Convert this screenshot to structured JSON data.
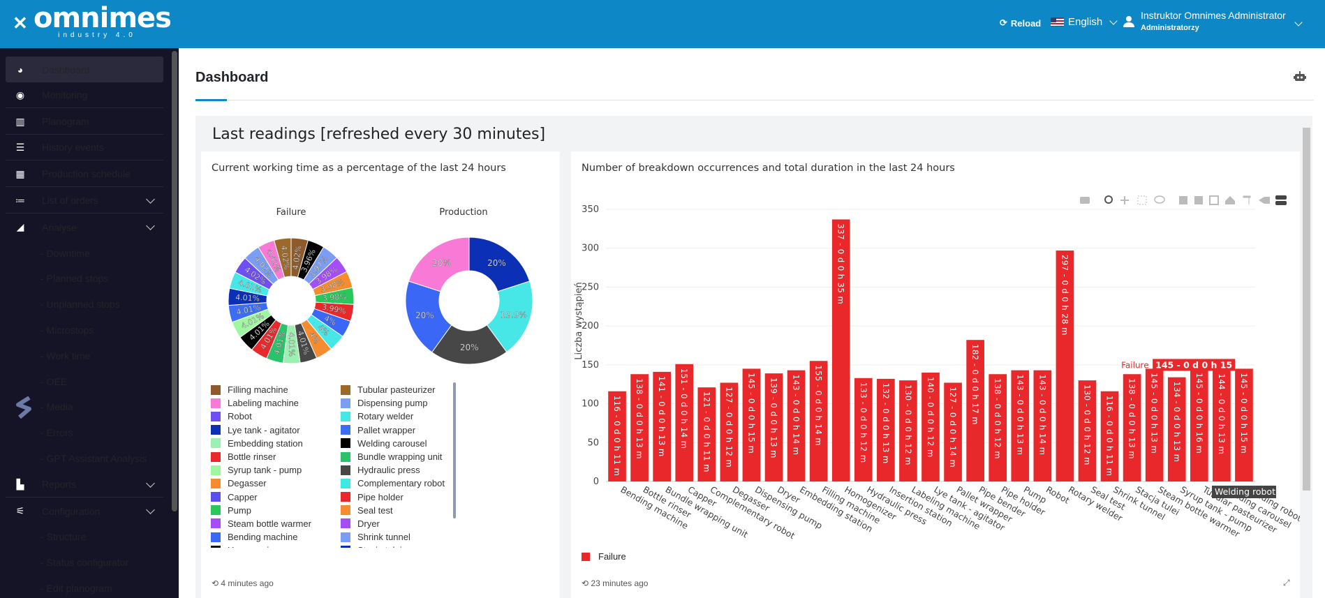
{
  "topbar": {
    "logo": "omnimes",
    "logo_sub": "industry 4.0",
    "reload": "Reload",
    "language": "English",
    "user_name": "Instruktor Omnimes Administrator",
    "user_role": "Administratorzy"
  },
  "sidebar": {
    "items": [
      {
        "label": "Dashboard",
        "icon": "gauge-icon"
      },
      {
        "label": "Monitoring",
        "icon": "eye-icon"
      },
      {
        "label": "Planogram",
        "icon": "map-icon"
      },
      {
        "label": "History events",
        "icon": "list-icon"
      },
      {
        "label": "Production schedule",
        "icon": "calendar-icon"
      },
      {
        "label": "List of orders",
        "icon": "list-ul-icon"
      },
      {
        "label": "Analyse",
        "icon": "chart-area-icon"
      }
    ],
    "analyse_sub": [
      "- Downtime",
      "- Planned stops",
      "- Unplanned stops",
      "- Microstops",
      "- Work time",
      "- OEE",
      "- Media",
      "- Errors",
      "- GPT Assistant Analysis"
    ],
    "reports": "Reports",
    "configuration": "Configuration",
    "config_sub": [
      "- Structure",
      "- Status configurator",
      "- Edit planogram"
    ]
  },
  "page": {
    "title": "Dashboard",
    "panel_title": "Last readings [refreshed every 30 minutes]"
  },
  "pie_card": {
    "title": "Current working time as a percentage of the last 24 hours",
    "updated": "4 minutes ago",
    "legend_left": [
      "Filling machine",
      "Labeling machine",
      "Robot",
      "Lye tank - agitator",
      "Embedding station",
      "Bottle rinser",
      "Syrup tank - pump",
      "Degasser",
      "Capper",
      "Pump",
      "Steam bottle warmer",
      "Bending machine",
      "Homogenizer"
    ],
    "legend_right": [
      "Tubular pasteurizer",
      "Dispensing pump",
      "Rotary welder",
      "Pallet wrapper",
      "Welding carousel",
      "Bundle wrapping unit",
      "Hydraulic press",
      "Complementary robot",
      "Pipe holder",
      "Seal test",
      "Dryer",
      "Shrink tunnel",
      "Stacja tulei"
    ],
    "legend_left_colors": [
      "#8c5a2b",
      "#f97ad6",
      "#6f4ef2",
      "#0b2fb5",
      "#9cf0b0",
      "#e8282a",
      "#9ff7a0",
      "#f58c2f",
      "#5b4ef0",
      "#28c85a",
      "#a64ef5",
      "#3a67f5",
      "#111111"
    ],
    "legend_right_colors": [
      "#9b6a2b",
      "#7b9ef5",
      "#47e7e7",
      "#3b6ef5",
      "#000000",
      "#2ac36a",
      "#474747",
      "#3fe9e3",
      "#e8282a",
      "#f58c2f",
      "#a64ef5",
      "#7b9ef5",
      "#0b2fb5"
    ]
  },
  "failure_pie": {
    "title": "Failure",
    "slices": [
      {
        "label": "4.02%",
        "value": 4.02,
        "color": "#8c5a2b"
      },
      {
        "label": "3.96%",
        "value": 3.96,
        "color": "#000000"
      },
      {
        "label": "3.97%",
        "value": 3.97,
        "color": "#7b9ef5"
      },
      {
        "label": "3.98%",
        "value": 3.98,
        "color": "#a64ef5"
      },
      {
        "label": "3.98%",
        "value": 3.98,
        "color": "#f58c2f"
      },
      {
        "label": "3.98%",
        "value": 3.98,
        "color": "#28c85a"
      },
      {
        "label": "3.99%",
        "value": 3.99,
        "color": "#e8282a"
      },
      {
        "label": "4%",
        "value": 4.0,
        "color": "#3a67f5"
      },
      {
        "label": "4%",
        "value": 4.0,
        "color": "#47e7e7"
      },
      {
        "label": "4%",
        "value": 4.0,
        "color": "#f58c2f"
      },
      {
        "label": "4.01%",
        "value": 4.01,
        "color": "#474747"
      },
      {
        "label": "4.01%",
        "value": 4.01,
        "color": "#9cf0b0"
      },
      {
        "label": "4.01%",
        "value": 4.01,
        "color": "#2ac36a"
      },
      {
        "label": "4.01%",
        "value": 4.01,
        "color": "#e8282a"
      },
      {
        "label": "4.01%",
        "value": 4.01,
        "color": "#000000"
      },
      {
        "label": "4.01%",
        "value": 4.01,
        "color": "#9ff7a0"
      },
      {
        "label": "4.01%",
        "value": 4.01,
        "color": "#3b6ef5"
      },
      {
        "label": "4.01%",
        "value": 4.01,
        "color": "#0b2fb5"
      },
      {
        "label": "4.01%",
        "value": 4.01,
        "color": "#47e7e7"
      },
      {
        "label": "4.02%",
        "value": 4.02,
        "color": "#6f4ef2"
      },
      {
        "label": "4.02%",
        "value": 4.02,
        "color": "#7b9ef5"
      },
      {
        "label": "4.02%",
        "value": 4.02,
        "color": "#f97ad6"
      },
      {
        "label": "4.02%",
        "value": 4.02,
        "color": "#9b6a2b"
      }
    ]
  },
  "production_pie": {
    "title": "Production",
    "slices": [
      {
        "label": "20%",
        "value": 20,
        "color": "#0b2fb5"
      },
      {
        "label": "19.9%",
        "value": 19.9,
        "color": "#47e7e7"
      },
      {
        "label": "20%",
        "value": 20,
        "color": "#474747"
      },
      {
        "label": "20%",
        "value": 20,
        "color": "#3a67f5"
      },
      {
        "label": "20%",
        "value": 20,
        "color": "#f97ad6"
      }
    ]
  },
  "bar_card": {
    "title": "Number of breakdown occurrences and total duration in the last 24 hours",
    "updated": "23 minutes ago",
    "legend": "Failure",
    "tooltip_value": "145 - 0 d 0 h 15 m",
    "tooltip_label": "Welding robot"
  },
  "chart_data": {
    "type": "bar",
    "ylabel": "Liczba wystąpień",
    "ylim": [
      0,
      350
    ],
    "yticks": [
      0,
      50,
      100,
      150,
      200,
      250,
      300,
      350
    ],
    "color": "#e8282a",
    "series": [
      {
        "name": "Failure",
        "categories": [
          "Bending machine",
          "Bottle rinser",
          "Bundle wrapping unit",
          "Capper",
          "Complementary robot",
          "Degasser",
          "Dispensing pump",
          "Dryer",
          "Embedding station",
          "Filling machine",
          "Homogenizer",
          "Hydraulic press",
          "Insertion station",
          "Labeling machine",
          "Lye tank - agitator",
          "Pallet wrapper",
          "Pipe bender",
          "Pipe holder",
          "Pump",
          "Robot",
          "Rotary welder",
          "Seal test",
          "Shrink tunnel",
          "Stacja tulei",
          "Steam bottle warmer",
          "Syrup tank - pump",
          "Tubular pasteurizer",
          "Welding carousel",
          "Welding robot"
        ],
        "values": [
          116,
          138,
          141,
          151,
          121,
          127,
          145,
          139,
          143,
          155,
          337,
          133,
          132,
          130,
          140,
          127,
          182,
          138,
          143,
          143,
          297,
          130,
          116,
          138,
          145,
          134,
          145,
          144,
          145
        ],
        "labels": [
          "116 - 0 d 0 h 11 m",
          "138 - 0 d 0 h 13 m",
          "141 - 0 d 0 h 13 m",
          "151 - 0 d 0 h 14 m",
          "121 - 0 d 0 h 11 m",
          "127 - 0 d 0 h 12 m",
          "145 - 0 d 0 h 15 m",
          "139 - 0 d 0 h 13 m",
          "143 - 0 d 0 h 14 m",
          "155 - 0 d 0 h 14 m",
          "337 - 0 d 0 h 35 m",
          "133 - 0 d 0 h 12 m",
          "132 - 0 d 0 h 13 m",
          "130 - 0 d 0 h 12 m",
          "140 - 0 d 0 h 12 m",
          "127 - 0 d 0 h 14 m",
          "182 - 0 d 0 h 17 m",
          "138 - 0 d 0 h 12 m",
          "143 - 0 d 0 h 13 m",
          "143 - 0 d 0 h 14 m",
          "297 - 0 d 0 h 28 m",
          "130 - 0 d 0 h 12 m",
          "116 - 0 d 0 h 11 m",
          "138 - 0 d 0 h 13 m",
          "145 - 0 d 0 h 13 m",
          "134 - 0 d 0 h 13 m",
          "145 - 0 d 0 h 16 m",
          "144 - 0 d 0 h 13 m",
          "145 - 0 d 0 h 15 m"
        ]
      }
    ]
  }
}
